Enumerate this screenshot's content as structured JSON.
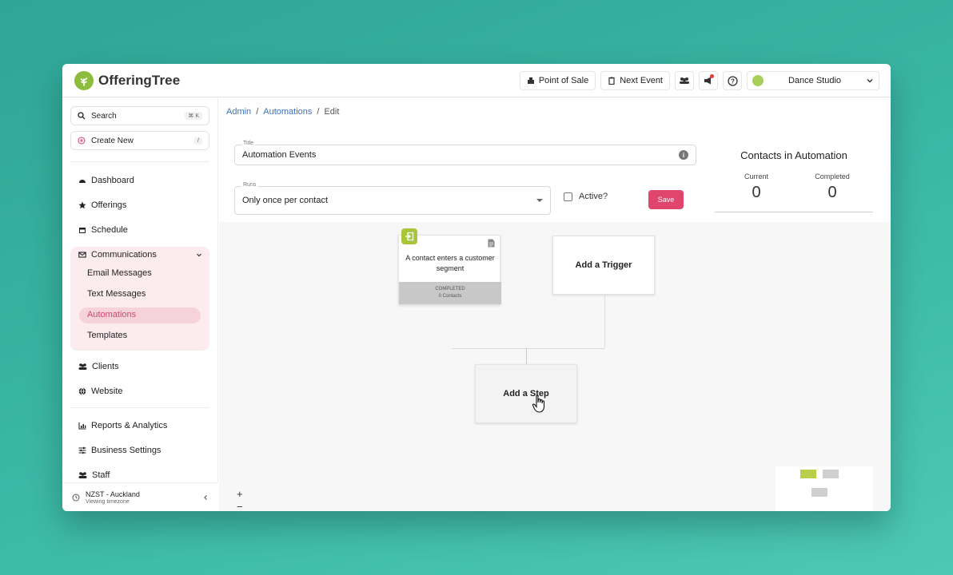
{
  "header": {
    "brand": "OfferingTree",
    "point_of_sale": "Point of Sale",
    "next_event": "Next Event",
    "studio": "Dance Studio"
  },
  "sidebar": {
    "search": "Search",
    "search_shortcut": "⌘ K",
    "create_new": "Create New",
    "create_shortcut": "/",
    "dashboard": "Dashboard",
    "offerings": "Offerings",
    "schedule": "Schedule",
    "communications": "Communications",
    "email_messages": "Email Messages",
    "text_messages": "Text Messages",
    "automations": "Automations",
    "templates": "Templates",
    "clients": "Clients",
    "website": "Website",
    "reports": "Reports & Analytics",
    "business_settings": "Business Settings",
    "staff": "Staff",
    "timezone": "NZST - Auckland",
    "timezone_sub": "Viewing timezone"
  },
  "breadcrumb": {
    "admin": "Admin",
    "sep1": "/",
    "automations": "Automations",
    "sep2": "/",
    "edit": "Edit"
  },
  "form": {
    "title_label": "Title",
    "title_value": "Automation Events",
    "runs_label": "Runs",
    "runs_value": "Only once per contact",
    "active_label": "Active?",
    "active_checked": false,
    "save": "Save"
  },
  "contacts": {
    "title": "Contacts in Automation",
    "current_label": "Current",
    "current_value": "0",
    "completed_label": "Completed",
    "completed_value": "0"
  },
  "canvas": {
    "segment_node_text": "A contact enters a customer segment",
    "segment_status": "COMPLETED",
    "segment_count": "0 Contacts",
    "add_trigger": "Add a Trigger",
    "add_step": "Add a Step",
    "zoom_in": "+",
    "zoom_out": "−"
  },
  "colors": {
    "accent": "#e0456e",
    "brand_green": "#8dbd3c",
    "link": "#3a73c4"
  }
}
